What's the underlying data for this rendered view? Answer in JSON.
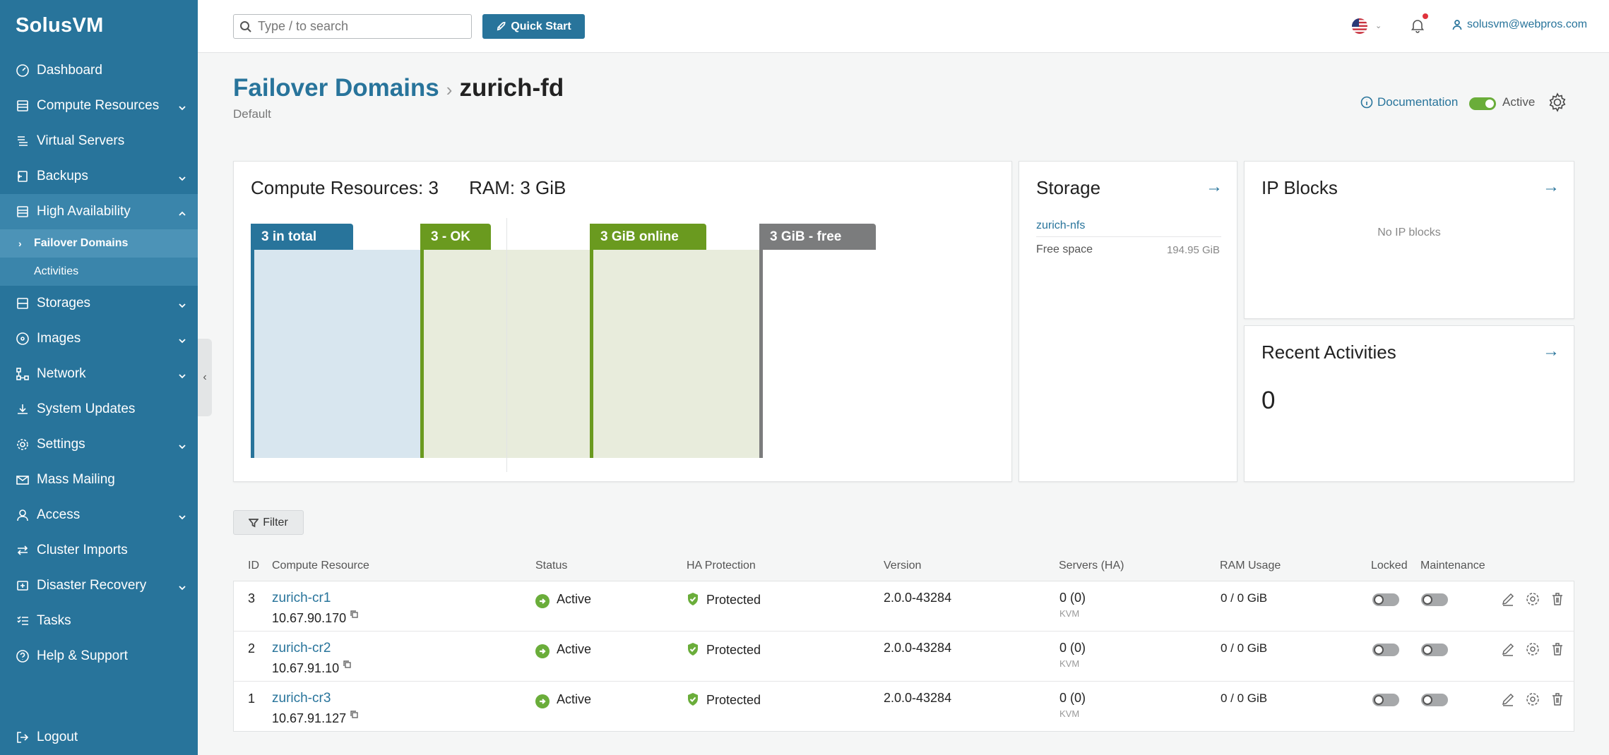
{
  "app": {
    "logo": "SolusVM"
  },
  "sidebar": {
    "items": [
      {
        "label": "Dashboard"
      },
      {
        "label": "Compute Resources"
      },
      {
        "label": "Virtual Servers"
      },
      {
        "label": "Backups"
      },
      {
        "label": "High Availability"
      },
      {
        "label": "Storages"
      },
      {
        "label": "Images"
      },
      {
        "label": "Network"
      },
      {
        "label": "System Updates"
      },
      {
        "label": "Settings"
      },
      {
        "label": "Mass Mailing"
      },
      {
        "label": "Access"
      },
      {
        "label": "Cluster Imports"
      },
      {
        "label": "Disaster Recovery"
      },
      {
        "label": "Tasks"
      },
      {
        "label": "Help & Support"
      }
    ],
    "sub_items": [
      {
        "label": "Failover Domains"
      },
      {
        "label": "Activities"
      }
    ],
    "logout": "Logout"
  },
  "topbar": {
    "search_placeholder": "Type / to search",
    "quick_start": "Quick Start",
    "user": "solusvm@webpros.com"
  },
  "header": {
    "breadcrumb_parent": "Failover Domains",
    "breadcrumb_current": "zurich-fd",
    "subtitle": "Default",
    "documentation": "Documentation",
    "status_label": "Active"
  },
  "compute_card": {
    "resources_label": "Compute Resources: 3",
    "ram_label": "RAM: 3 GiB",
    "bars": [
      {
        "label": "3 in total",
        "color": "#28749b"
      },
      {
        "label": "3 - OK",
        "color": "#6a9a1f"
      },
      {
        "label": "3 GiB online",
        "color": "#6a9a1f"
      },
      {
        "label": "3 GiB - free",
        "color": "#7b7c7d"
      }
    ]
  },
  "storage_card": {
    "title": "Storage",
    "name": "zurich-nfs",
    "free_label": "Free space",
    "free_value": "194.95 GiB"
  },
  "ip_card": {
    "title": "IP Blocks",
    "empty": "No IP blocks"
  },
  "activities_card": {
    "title": "Recent Activities",
    "count": "0"
  },
  "filter": {
    "label": "Filter"
  },
  "table": {
    "headers": [
      "ID",
      "Compute Resource",
      "Status",
      "HA Protection",
      "Version",
      "Servers (HA)",
      "RAM Usage",
      "Locked",
      "Maintenance"
    ],
    "rows": [
      {
        "id": "3",
        "name": "zurich-cr1",
        "ip": "10.67.90.170",
        "status": "Active",
        "ha": "Protected",
        "version": "2.0.0-43284",
        "servers": "0 (0)",
        "virt": "KVM",
        "ram": "0 / 0 GiB",
        "locked": false,
        "maintenance": false
      },
      {
        "id": "2",
        "name": "zurich-cr2",
        "ip": "10.67.91.10",
        "status": "Active",
        "ha": "Protected",
        "version": "2.0.0-43284",
        "servers": "0 (0)",
        "virt": "KVM",
        "ram": "0 / 0 GiB",
        "locked": false,
        "maintenance": false
      },
      {
        "id": "1",
        "name": "zurich-cr3",
        "ip": "10.67.91.127",
        "status": "Active",
        "ha": "Protected",
        "version": "2.0.0-43284",
        "servers": "0 (0)",
        "virt": "KVM",
        "ram": "0 / 0 GiB",
        "locked": false,
        "maintenance": false
      }
    ]
  },
  "colors": {
    "sidebar": "#28749b",
    "accent": "#28749b",
    "success": "#6aad3a"
  }
}
